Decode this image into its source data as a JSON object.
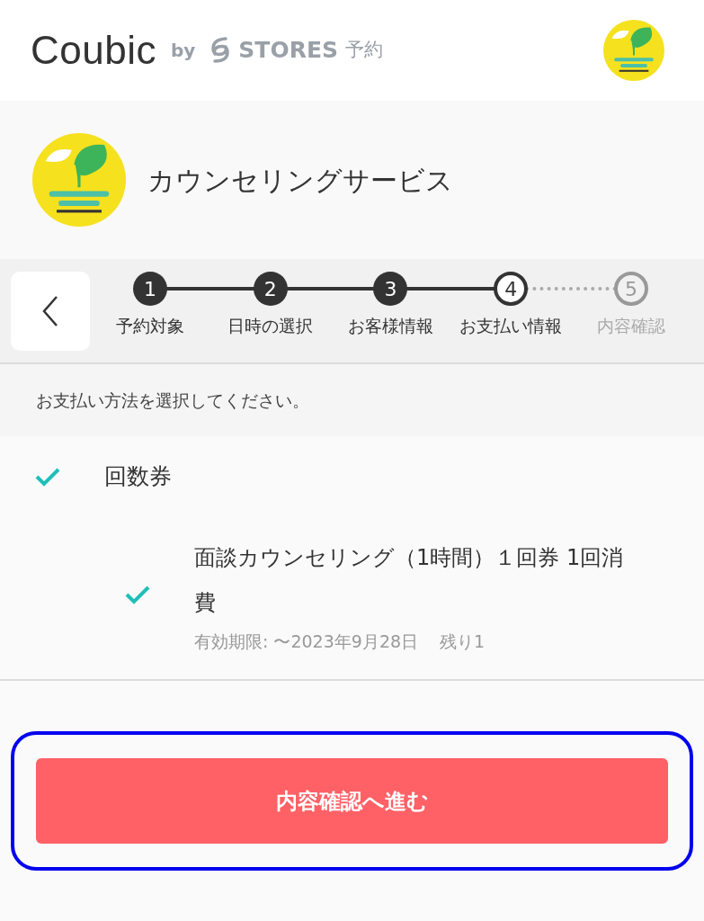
{
  "header": {
    "brand": "Coubic",
    "by": "by",
    "partner": "STORES",
    "partner_suffix": "予約"
  },
  "shop": {
    "name": "カウンセリングサービス"
  },
  "stepper": {
    "steps": [
      {
        "number": "1",
        "label": "予約対象",
        "completed": true,
        "selected": false
      },
      {
        "number": "2",
        "label": "日時の選択",
        "completed": true,
        "selected": false
      },
      {
        "number": "3",
        "label": "お客様情報",
        "completed": true,
        "selected": false
      },
      {
        "number": "4",
        "label": "お支払い情報",
        "completed": false,
        "selected": true
      },
      {
        "number": "5",
        "label": "内容確認",
        "completed": false,
        "selected": false
      }
    ]
  },
  "instruction": "お支払い方法を選択してください。",
  "payment_methods": [
    {
      "label": "回数券",
      "checked": true,
      "tickets": [
        {
          "title": "面談カウンセリング（1時間）１回券  1回消費",
          "expiry": "有効期限: 〜2023年9月28日",
          "remaining": "残り1",
          "checked": true
        }
      ]
    }
  ],
  "submit_button": {
    "label": "内容確認へ進む",
    "focused": true
  }
}
